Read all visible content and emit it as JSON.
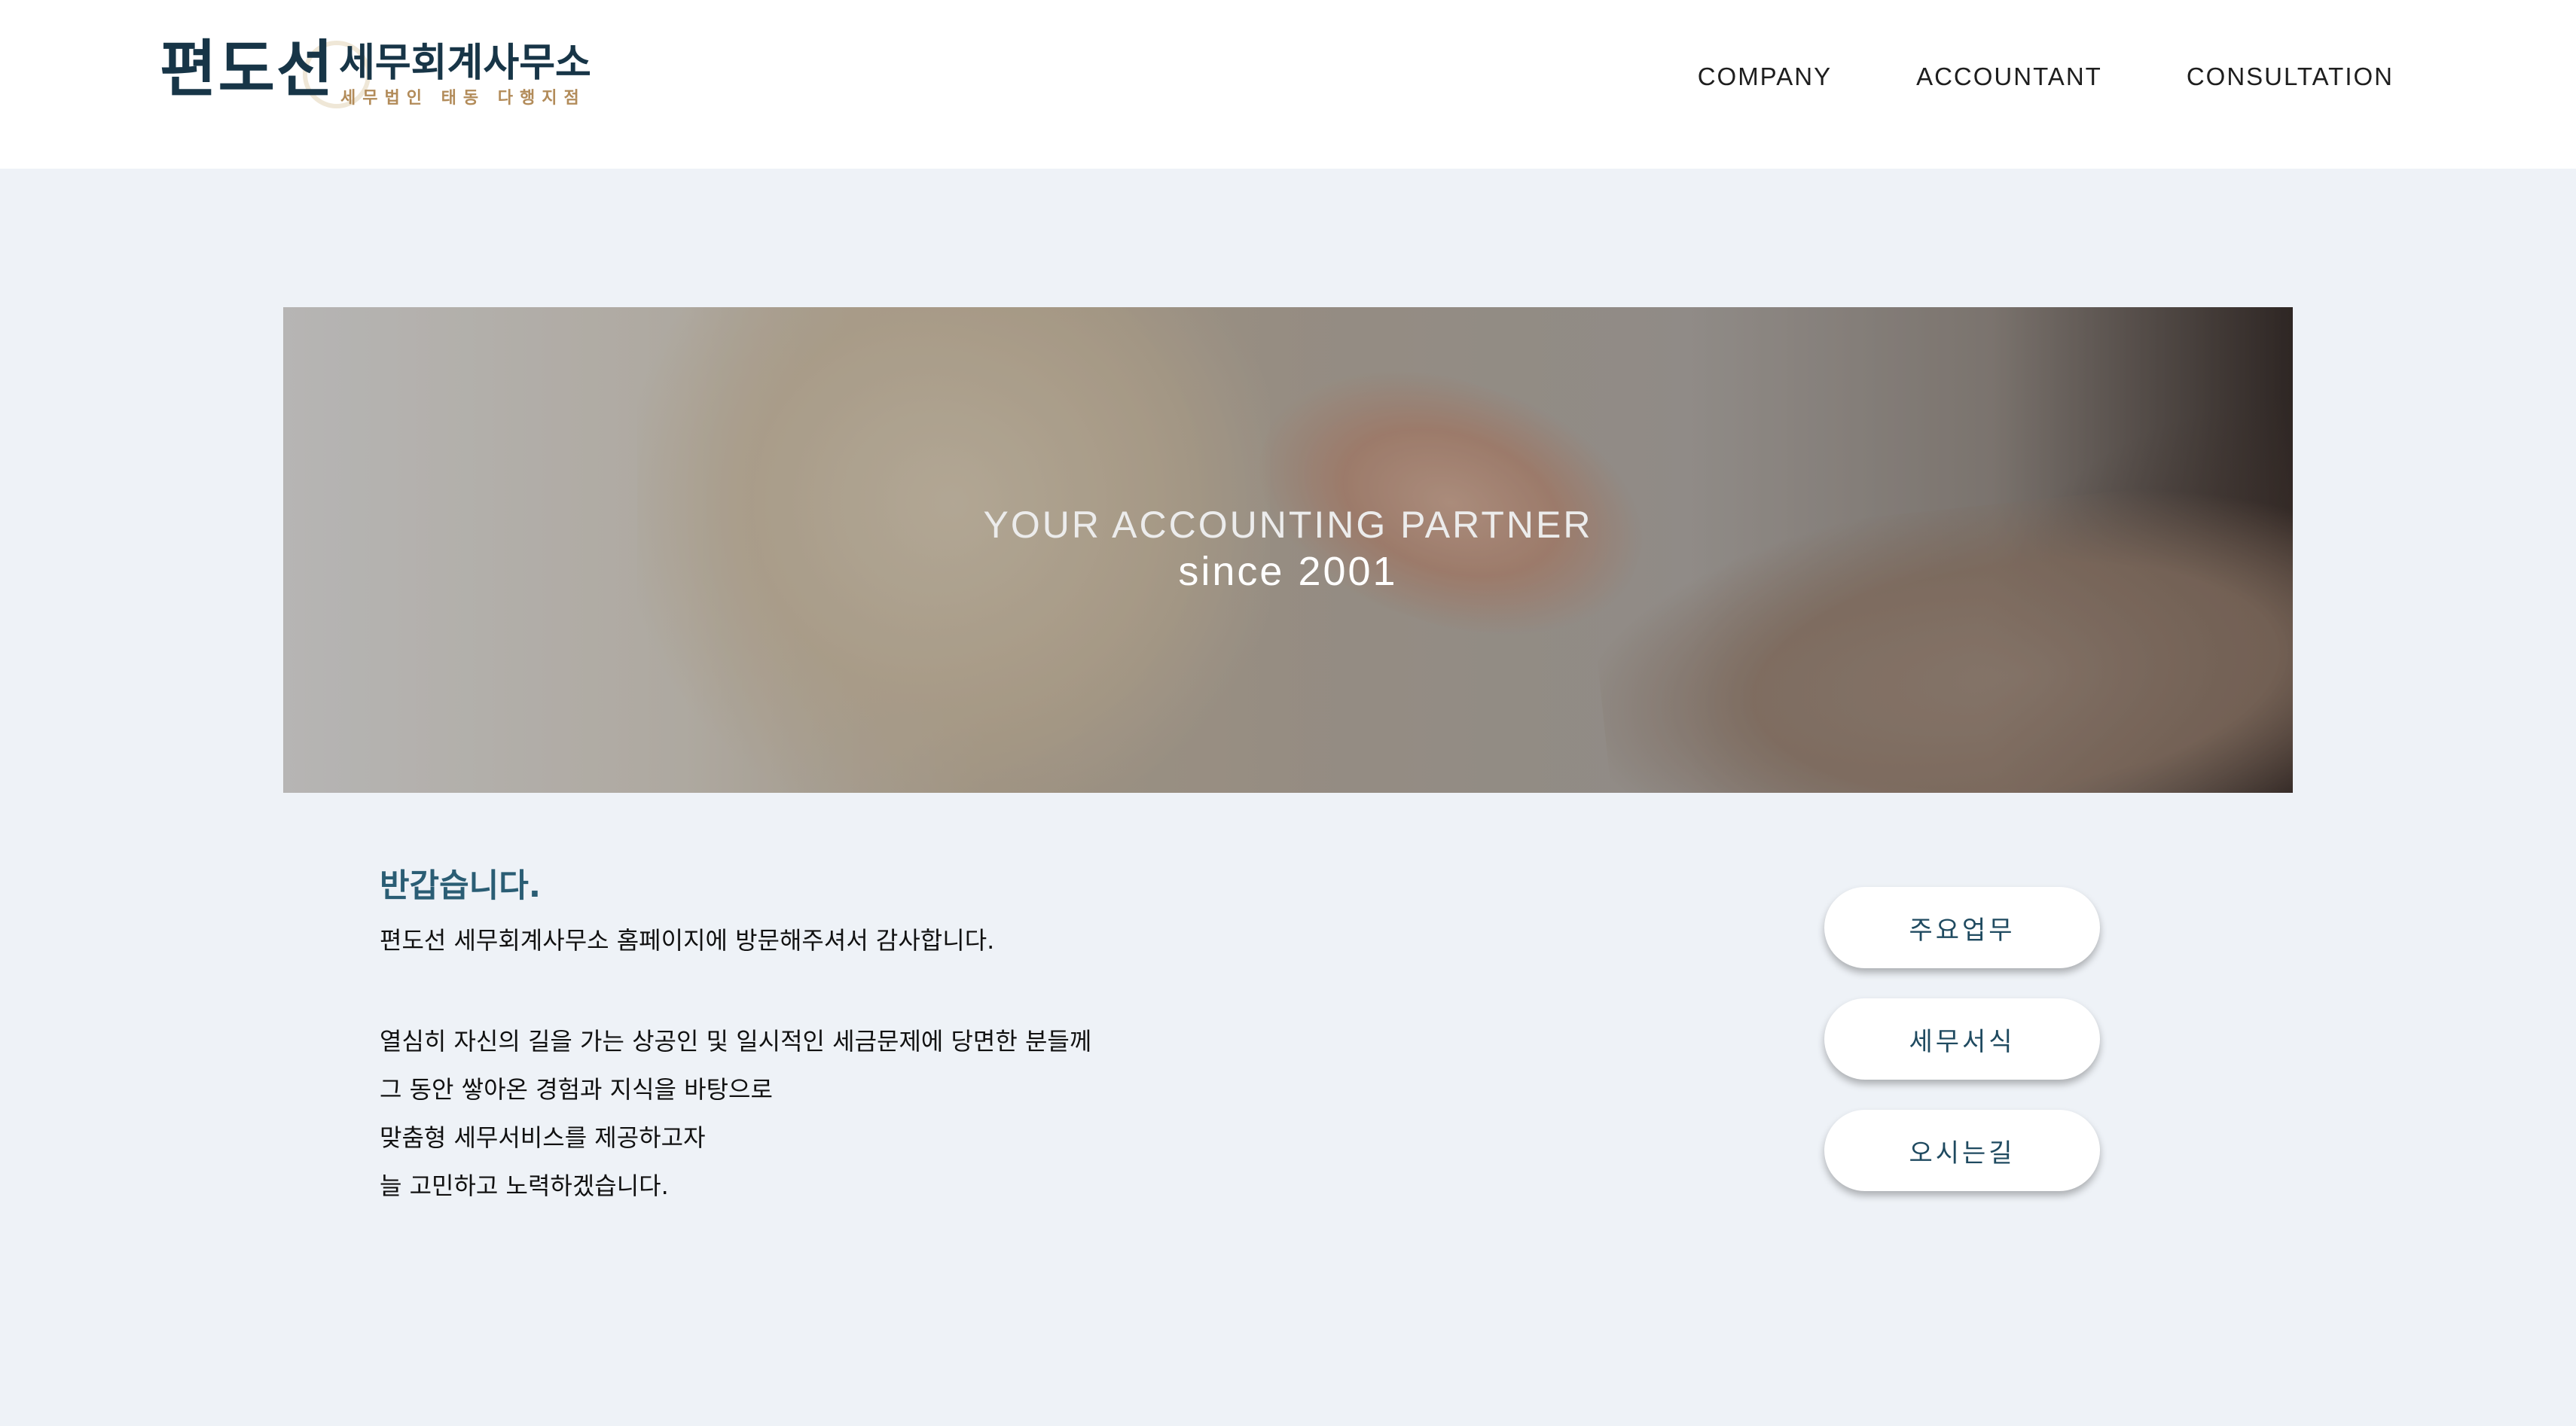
{
  "header": {
    "logo": {
      "name": "편도선",
      "title": "세무회계사무소",
      "subtitle": "세무법인 태동 다행지점"
    },
    "nav": [
      {
        "label": "COMPANY"
      },
      {
        "label": "ACCOUNTANT"
      },
      {
        "label": "CONSULTATION"
      }
    ]
  },
  "hero": {
    "line1": "YOUR ACCOUNTING PARTNER",
    "line2": "since 2001"
  },
  "welcome": {
    "title": "반갑습니다.",
    "intro": "편도선 세무회계사무소 홈페이지에 방문해주셔서 감사합니다.",
    "lines": [
      "열심히 자신의 길을 가는 상공인 및 일시적인 세금문제에 당면한 분들께",
      "그 동안 쌓아온 경험과 지식을 바탕으로",
      "맞춤형 세무서비스를 제공하고자",
      "늘 고민하고 노력하겠습니다."
    ]
  },
  "side_buttons": [
    {
      "label": "주요업무"
    },
    {
      "label": "세무서식"
    },
    {
      "label": "오시는길"
    }
  ],
  "colors": {
    "background": "#eef2f7",
    "header_bg": "#ffffff",
    "logo_navy": "#173547",
    "logo_gold": "#b28b59",
    "title_teal": "#2a5d74",
    "button_text": "#1f4a60"
  }
}
